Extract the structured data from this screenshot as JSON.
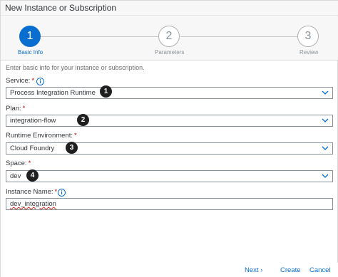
{
  "dialog": {
    "title": "New Instance or Subscription"
  },
  "wizard": {
    "steps": [
      {
        "number": "1",
        "label": "Basic Info",
        "state": "active"
      },
      {
        "number": "2",
        "label": "Parameters",
        "state": "inactive"
      },
      {
        "number": "3",
        "label": "Review",
        "state": "inactive"
      }
    ]
  },
  "form": {
    "intro": "Enter basic info for your instance or subscription.",
    "service": {
      "label": "Service:",
      "required": "*",
      "value": "Process Integration Runtime"
    },
    "plan": {
      "label": "Plan:",
      "required": "*",
      "value": "integration-flow"
    },
    "runtime": {
      "label": "Runtime Environment:",
      "required": "*",
      "value": "Cloud Foundry"
    },
    "space": {
      "label": "Space:",
      "required": "*",
      "value": "dev"
    },
    "instance_name": {
      "label": "Instance Name:",
      "required": "*",
      "value": "dev_integration"
    }
  },
  "badges": [
    "1",
    "2",
    "3",
    "4"
  ],
  "footer": {
    "next": "Next",
    "next_chevron": "›",
    "create": "Create",
    "cancel": "Cancel"
  },
  "icons": {
    "info": "info-icon",
    "chevron": "chevron-down-icon"
  },
  "colors": {
    "accent": "#0a6ed1",
    "required": "#bb0000",
    "badge": "#1f1f1f"
  }
}
